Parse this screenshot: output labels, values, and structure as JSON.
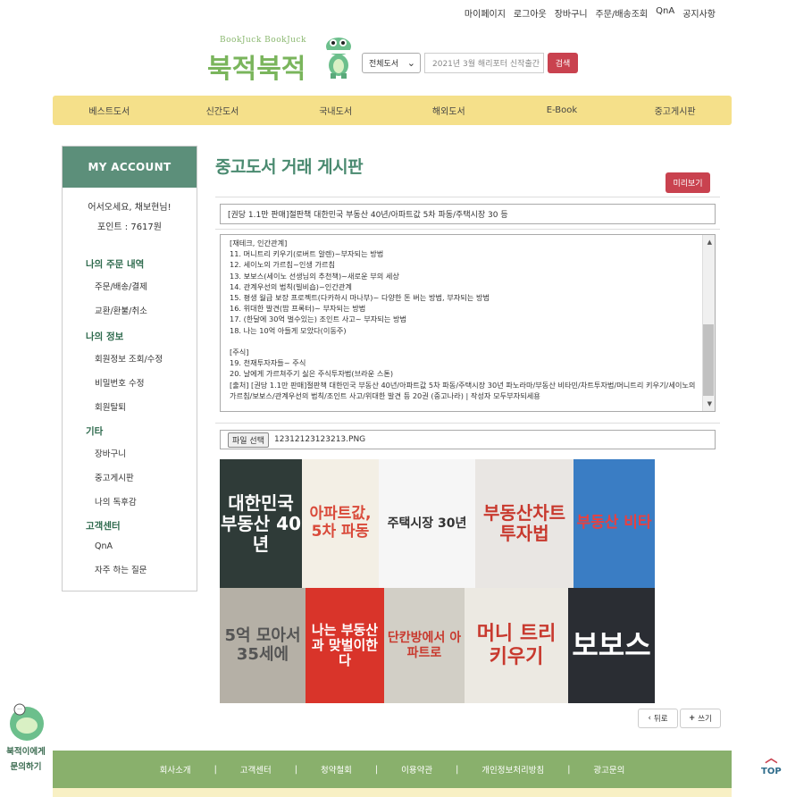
{
  "util_links": [
    "마이페이지",
    "로그아웃",
    "장바구니",
    "주문/배송조회",
    "QnA",
    "공지사항"
  ],
  "logo": {
    "small": "BookJuck BookJuck",
    "big": "북적북적"
  },
  "search": {
    "category": "전체도서",
    "placeholder": "2021년 3월 해리포터 신작출간",
    "button": "검색"
  },
  "gnb": [
    "베스트도서",
    "신간도서",
    "국내도서",
    "해외도서",
    "E-Book",
    "중고게시판"
  ],
  "sidebar": {
    "header": "MY ACCOUNT",
    "greeting": "어서오세요, 채보현님!",
    "points": "포인트 : 7617원",
    "sections": [
      {
        "title": "나의 주문 내역",
        "items": [
          "주문/배송/결제",
          "교환/환불/취소"
        ]
      },
      {
        "title": "나의 정보",
        "items": [
          "회원정보 조회/수정",
          "비밀번호 수정",
          "회원탈퇴"
        ]
      },
      {
        "title": "기타",
        "items": [
          "장바구니",
          "중고게시판",
          "나의 독후감"
        ]
      },
      {
        "title": "고객센터",
        "items": [
          "QnA",
          "자주 하는 질문"
        ]
      }
    ]
  },
  "page_title": "중고도서 거래 게시판",
  "preview_button": "미리보기",
  "subject": "[권당 1.1만 판매]절판책 대한민국 부동산 40년/아파트값 5차 파동/주택시장 30 등",
  "body_text": "[재테크, 인간관계]\n11. 머니트리 키우기(로버트 알렌)~부자되는 방법\n12. 세이노의 가르침~인생 가르침\n13. 보보스(세이노 선생님의 추천책)~새로운 부의 세상\n14. 관계우선의 법칙(빌비숍)~인간관계\n15. 평생 월급 보장 프로젝트(다카하시 마나부)~ 다양한 돈 버는 방법, 부자되는 방법\n16. 위대한 발견(밥 프록터)~ 부자되는 방법\n17. (한달에 30억 벌수있는) 조인트 사고~ 부자되는 방법\n18. 나는 10억 아들게 모았다(이동주)\n\n[주식]\n19. 천재투자자들~ 주식\n20. 날에게 가르쳐주기 싫은 주식투자법(브라운 스톤)\n[출처] [권당 1.1만 판매]절판책 대한민국 부동산 40년/아파트값 5차 파동/주택시장 30년 파노라마/부동산 비타민/차트투자법/머니트리 키우기/세이노의 가르침/보보스/관계우선의 법칙/조인트 사고/위대한 발견 등 20권 (중고나라) | 작성자 모두부자되세용",
  "file": {
    "button": "파일 선택",
    "name": "12312123123213.PNG"
  },
  "photo_books": [
    "대한민국 부동산 40년",
    "아파트값, 5차 파동",
    "주택시장 30년",
    "부동산차트 투자법",
    "부동산 비타",
    "5억 모아서 35세에",
    "나는 부동산과 맞벌이한다",
    "단칸방에서 아파트로",
    "머니 트리 키우기",
    "보보스"
  ],
  "buttons": {
    "back": "뒤로",
    "write": "쓰기"
  },
  "footer": [
    "회사소개",
    "고객센터",
    "청약철회",
    "이용약관",
    "개인정보처리방침",
    "광고문의"
  ],
  "chat": {
    "line1": "북적이에게",
    "line2": "문의하기"
  },
  "top_label": "TOP"
}
